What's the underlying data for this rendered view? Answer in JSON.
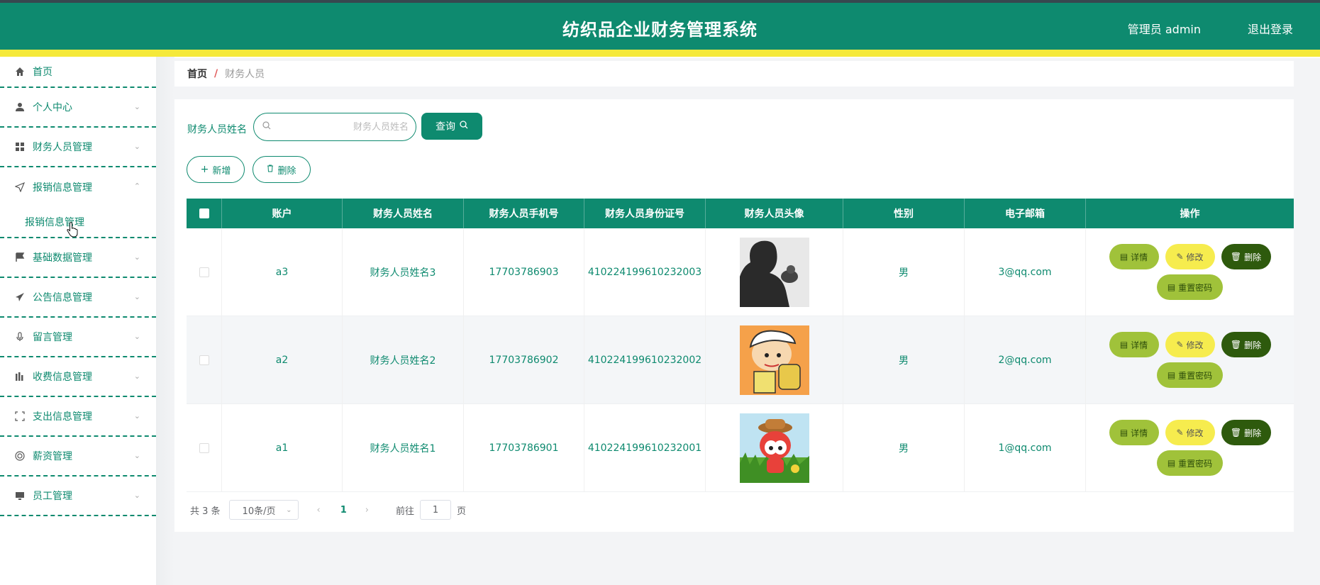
{
  "header": {
    "title": "纺织品企业财务管理系统",
    "user": "管理员 admin",
    "logout": "退出登录"
  },
  "sidebar": {
    "items": [
      {
        "label": "首页",
        "icon": "home-icon"
      },
      {
        "label": "个人中心",
        "icon": "user-icon"
      },
      {
        "label": "财务人员管理",
        "icon": "grid-icon"
      },
      {
        "label": "报销信息管理",
        "icon": "send-icon",
        "expanded": true
      },
      {
        "label": "报销信息管理",
        "icon": "",
        "sub": true
      },
      {
        "label": "基础数据管理",
        "icon": "flag-icon"
      },
      {
        "label": "公告信息管理",
        "icon": "plane-icon"
      },
      {
        "label": "留言管理",
        "icon": "mic-icon"
      },
      {
        "label": "收费信息管理",
        "icon": "chart-icon"
      },
      {
        "label": "支出信息管理",
        "icon": "frame-icon"
      },
      {
        "label": "薪资管理",
        "icon": "circle-icon"
      },
      {
        "label": "员工管理",
        "icon": "monitor-icon"
      }
    ]
  },
  "breadcrumb": {
    "home": "首页",
    "sep": "/",
    "current": "财务人员"
  },
  "search": {
    "label": "财务人员姓名",
    "placeholder": "财务人员姓名",
    "query": "查询"
  },
  "actions": {
    "add": "新增",
    "delete": "删除"
  },
  "table": {
    "headers": [
      "账户",
      "财务人员姓名",
      "财务人员手机号",
      "财务人员身份证号",
      "财务人员头像",
      "性别",
      "电子邮箱",
      "操作"
    ],
    "rows": [
      {
        "account": "a3",
        "name": "财务人员姓名3",
        "phone": "17703786903",
        "idcard": "410224199610232003",
        "gender": "男",
        "email": "3@qq.com"
      },
      {
        "account": "a2",
        "name": "财务人员姓名2",
        "phone": "17703786902",
        "idcard": "410224199610232002",
        "gender": "男",
        "email": "2@qq.com"
      },
      {
        "account": "a1",
        "name": "财务人员姓名1",
        "phone": "17703786901",
        "idcard": "410224199610232001",
        "gender": "男",
        "email": "1@qq.com"
      }
    ],
    "ops": {
      "detail": "详情",
      "edit": "修改",
      "delete": "删除",
      "reset": "重置密码"
    }
  },
  "pagination": {
    "total": "共 3 条",
    "page_size": "10条/页",
    "current": "1",
    "goto_prefix": "前往",
    "goto_value": "1",
    "goto_suffix": "页"
  },
  "colors": {
    "primary": "#0e8a6f",
    "accent_yellow": "#f5e93a",
    "detail_btn": "#a0c23a",
    "edit_btn": "#f6ec4e",
    "delete_btn": "#2e5a0d"
  }
}
